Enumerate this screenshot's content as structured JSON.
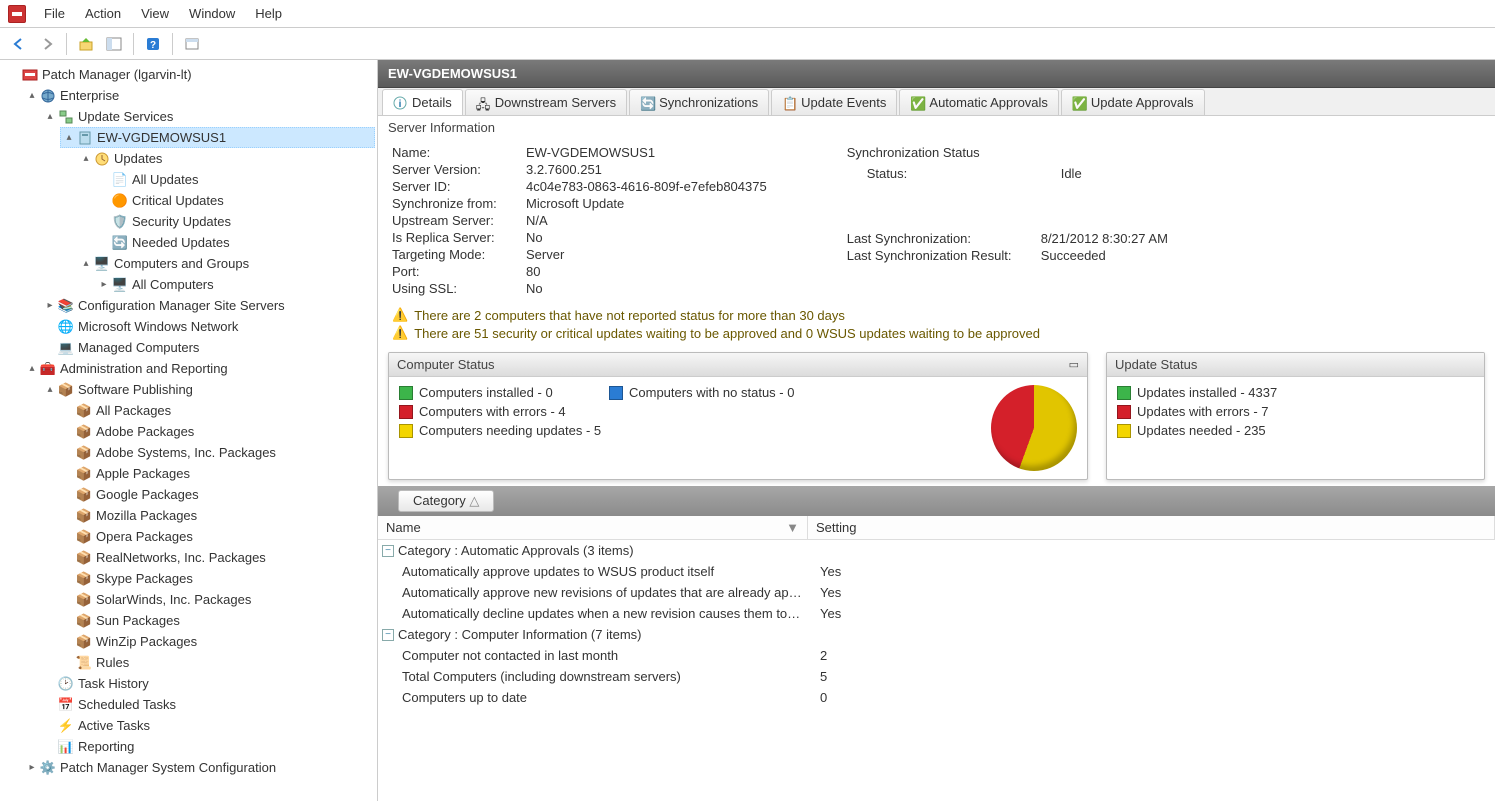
{
  "menu": {
    "file": "File",
    "action": "Action",
    "view": "View",
    "window": "Window",
    "help": "Help"
  },
  "tree": {
    "root": "Patch Manager (lgarvin-lt)",
    "enterprise": "Enterprise",
    "updateServices": "Update Services",
    "server": "EW-VGDEMOWSUS1",
    "updates": "Updates",
    "allUpdates": "All Updates",
    "criticalUpdates": "Critical Updates",
    "securityUpdates": "Security Updates",
    "neededUpdates": "Needed Updates",
    "computersGroups": "Computers and Groups",
    "allComputers": "All Computers",
    "cfgMgr": "Configuration Manager Site Servers",
    "msNetwork": "Microsoft Windows Network",
    "managedComp": "Managed Computers",
    "adminReport": "Administration and Reporting",
    "softwarePub": "Software Publishing",
    "allPackages": "All Packages",
    "adobePackages": "Adobe Packages",
    "adobeSystems": "Adobe Systems, Inc. Packages",
    "apple": "Apple Packages",
    "google": "Google Packages",
    "mozilla": "Mozilla Packages",
    "opera": "Opera Packages",
    "realnetworks": "RealNetworks, Inc. Packages",
    "skype": "Skype Packages",
    "solarwinds": "SolarWinds, Inc. Packages",
    "sun": "Sun Packages",
    "winzip": "WinZip Packages",
    "rules": "Rules",
    "taskHistory": "Task History",
    "scheduledTasks": "Scheduled Tasks",
    "activeTasks": "Active Tasks",
    "reporting": "Reporting",
    "sysConfig": "Patch Manager System Configuration"
  },
  "header": {
    "title": "EW-VGDEMOWSUS1"
  },
  "tabs": {
    "details": "Details",
    "downstream": "Downstream Servers",
    "sync": "Synchronizations",
    "events": "Update Events",
    "autoApprove": "Automatic Approvals",
    "updApprove": "Update Approvals"
  },
  "section": {
    "serverInfo": "Server Information"
  },
  "info": {
    "nameLabel": "Name:",
    "name": "EW-VGDEMOWSUS1",
    "versionLabel": "Server Version:",
    "version": "3.2.7600.251",
    "idLabel": "Server ID:",
    "id": "4c04e783-0863-4616-809f-e7efeb804375",
    "syncFromLabel": "Synchronize from:",
    "syncFrom": "Microsoft Update",
    "upstreamLabel": "Upstream Server:",
    "upstream": "N/A",
    "replicaLabel": "Is Replica Server:",
    "replica": "No",
    "targetLabel": "Targeting Mode:",
    "target": "Server",
    "portLabel": "Port:",
    "port": "80",
    "sslLabel": "Using SSL:",
    "ssl": "No"
  },
  "syncStatus": {
    "heading": "Synchronization Status",
    "statusLabel": "Status:",
    "status": "Idle",
    "lastSyncLabel": "Last Synchronization:",
    "lastSync": "8/21/2012 8:30:27 AM",
    "lastResultLabel": "Last Synchronization Result:",
    "lastResult": "Succeeded"
  },
  "warnings": {
    "w1": "There are 2 computers that have not reported status for more than 30 days",
    "w2": "There are 51 security or critical updates waiting to be approved and 0 WSUS updates waiting to be approved"
  },
  "panels": {
    "compStatus": "Computer Status",
    "updStatus": "Update Status",
    "compInstalled": "Computers installed - 0",
    "compErrors": "Computers with errors - 4",
    "compNeeding": "Computers needing updates - 5",
    "compNoStatus": "Computers with no status - 0",
    "updInstalled": "Updates installed - 4337",
    "updErrors": "Updates with errors - 7",
    "updNeeded": "Updates needed - 235"
  },
  "chart_data": {
    "type": "pie",
    "title": "Computer Status",
    "series": [
      {
        "name": "Computers installed",
        "value": 0,
        "color": "#3cb54a"
      },
      {
        "name": "Computers with errors",
        "value": 4,
        "color": "#d4202a"
      },
      {
        "name": "Computers needing updates",
        "value": 5,
        "color": "#e1c500"
      },
      {
        "name": "Computers with no status",
        "value": 0,
        "color": "#2a7cd4"
      }
    ]
  },
  "grid": {
    "groupBy": "Category",
    "colName": "Name",
    "colSetting": "Setting",
    "cat1": "Category : Automatic Approvals (3 items)",
    "r1": "Automatically approve updates to WSUS product itself",
    "v1": "Yes",
    "r2": "Automatically approve new revisions of updates that are already ap…",
    "v2": "Yes",
    "r3": "Automatically decline updates when a new revision causes them to…",
    "v3": "Yes",
    "cat2": "Category : Computer Information (7 items)",
    "r4": "Computer not contacted in last month",
    "v4": "2",
    "r5": "Total Computers (including downstream servers)",
    "v5": "5",
    "r6": "Computers up to date",
    "v6": "0"
  }
}
